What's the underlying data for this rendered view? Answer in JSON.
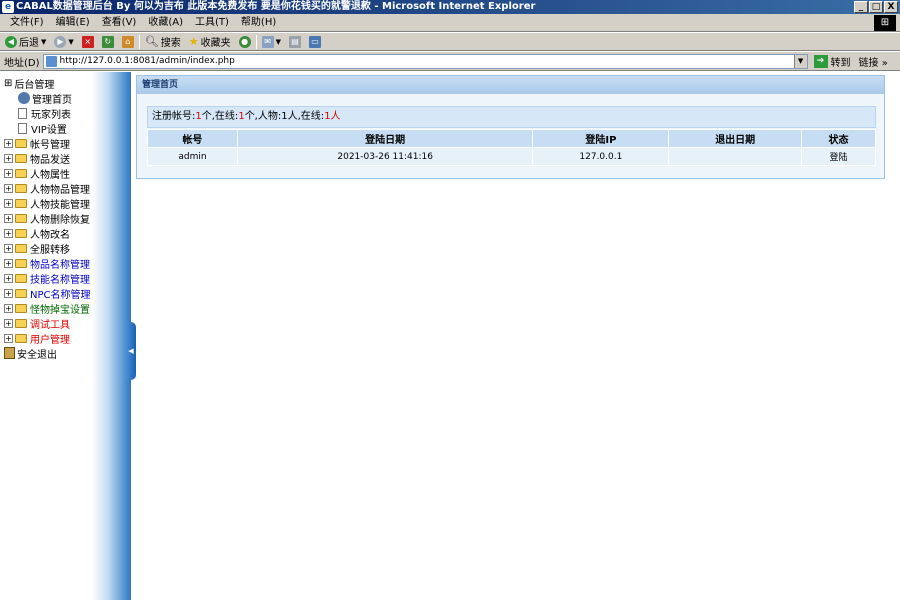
{
  "window": {
    "title": "CABAL数据管理后台 By 何以为吉布 此版本免费发布 要是你花钱买的就警退款 - Microsoft Internet Explorer",
    "icon": "ie-icon",
    "buttons": {
      "minimize": "_",
      "maximize": "□",
      "close": "X"
    }
  },
  "menubar": {
    "items": [
      "文件(F)",
      "编辑(E)",
      "查看(V)",
      "收藏(A)",
      "工具(T)",
      "帮助(H)"
    ]
  },
  "toolbar": {
    "back": "后退",
    "search": "搜索",
    "favorites": "收藏夹"
  },
  "addressbar": {
    "label": "地址(D)",
    "url": "http://127.0.0.1:8081/admin/index.php",
    "go": "转到",
    "links": "链接 »"
  },
  "sidebar": {
    "root": "后台管理",
    "items": [
      {
        "label": "管理首页",
        "type": "gear",
        "color": "#000000"
      },
      {
        "label": "玩家列表",
        "type": "doc",
        "color": "#000000"
      },
      {
        "label": "VIP设置",
        "type": "doc",
        "color": "#000000"
      },
      {
        "label": "帐号管理",
        "type": "folder",
        "color": "#000000"
      },
      {
        "label": "物品发送",
        "type": "folder",
        "color": "#000000"
      },
      {
        "label": "人物属性",
        "type": "folder",
        "color": "#000000"
      },
      {
        "label": "人物物品管理",
        "type": "folder",
        "color": "#000000"
      },
      {
        "label": "人物技能管理",
        "type": "folder",
        "color": "#000000"
      },
      {
        "label": "人物删除恢复",
        "type": "folder",
        "color": "#000000"
      },
      {
        "label": "人物改名",
        "type": "folder",
        "color": "#000000"
      },
      {
        "label": "全服转移",
        "type": "folder",
        "color": "#000000"
      },
      {
        "label": "物品名称管理",
        "type": "folder",
        "color": "#0000cc"
      },
      {
        "label": "技能名称管理",
        "type": "folder",
        "color": "#0000cc"
      },
      {
        "label": "NPC名称管理",
        "type": "folder",
        "color": "#0000cc"
      },
      {
        "label": "怪物掉宝设置",
        "type": "folder",
        "color": "#006600"
      },
      {
        "label": "调试工具",
        "type": "folder",
        "color": "#dd0000"
      },
      {
        "label": "用户管理",
        "type": "folder",
        "color": "#dd0000"
      }
    ],
    "exit": "安全退出"
  },
  "panel": {
    "title": "管理首页",
    "stats": {
      "reg_label": "注册帐号:",
      "reg_count": "1",
      "reg_unit": "个,在线:",
      "online_count": "1",
      "online_unit": "个,人物:",
      "char_count": "1人",
      "char_online_label": ",在线:",
      "char_online": "1人"
    },
    "table": {
      "headers": [
        "帐号",
        "登陆日期",
        "登陆IP",
        "退出日期",
        "状态"
      ],
      "rows": [
        [
          "admin",
          "2021-03-26 11:41:16",
          "127.0.0.1",
          "",
          "登陆"
        ]
      ]
    }
  }
}
